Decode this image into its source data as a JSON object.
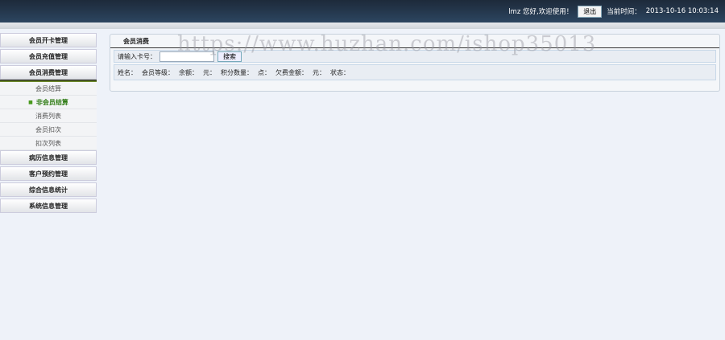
{
  "header": {
    "greeting": "lmz 您好,欢迎使用！",
    "logout": "退出",
    "time_label": "当前时间：",
    "time": "2013-10-16 10:03:14"
  },
  "sidebar": {
    "items": [
      "会员开卡管理",
      "会员充值管理",
      "会员消费管理"
    ],
    "sub": [
      "会员结算",
      "非会员结算",
      "消费列表",
      "会员扣次",
      "扣次列表"
    ],
    "items2": [
      "病历信息管理",
      "客户预约管理",
      "综合信息统计",
      "系统信息管理"
    ]
  },
  "panel": {
    "title": "会员消费",
    "card_label": "请输入卡号：",
    "card_value": "",
    "search": "搜索",
    "info": [
      "姓名：",
      "会员等级：",
      "余额：",
      "元：",
      "积分数量：",
      "点：",
      "欠费金额：",
      "元：",
      "状态："
    ]
  },
  "watermark": "https://www.huzhan.com/ishop35013"
}
